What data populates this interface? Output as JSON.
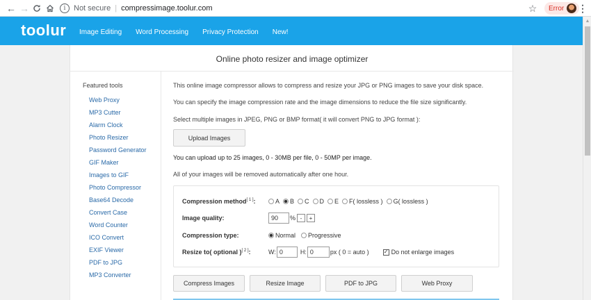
{
  "browser": {
    "not_secure": "Not secure",
    "separator": "|",
    "url": "compressimage.toolur.com",
    "error_label": "Error",
    "icons": {
      "back": "arrow-left",
      "forward": "arrow-right",
      "reload": "reload",
      "home": "home",
      "info": "info",
      "star": "star",
      "menu": "kebab-menu"
    }
  },
  "header": {
    "logo": "toolur",
    "nav": [
      "Image Editing",
      "Word Processing",
      "Privacy Protection",
      "New!"
    ],
    "accent_color": "#1aa3e8"
  },
  "page": {
    "title": "Online photo resizer and image optimizer"
  },
  "sidebar": {
    "heading": "Featured tools",
    "items": [
      "Web Proxy",
      "MP3 Cutter",
      "Alarm Clock",
      "Photo Resizer",
      "Password Generator",
      "GIF Maker",
      "Images to GIF",
      "Photo Compressor",
      "Base64 Decode",
      "Convert Case",
      "Word Counter",
      "ICO Convert",
      "EXIF Viewer",
      "PDF to JPG",
      "MP3 Converter"
    ]
  },
  "intro": {
    "p1": "This online image compressor allows to compress and resize your JPG or PNG images to save your disk space.",
    "p2": "You can specify the image compression rate and the image dimensions to reduce the file size significantly.",
    "p3": "Select multiple images in JPEG, PNG or BMP format( it will convert PNG to JPG format ):",
    "upload_button": "Upload Images",
    "limits": "You can upload up to 25 images, 0 - 30MB per file, 0 - 50MP per image.",
    "removal_note": "All of your images will be removed automatically after one hour."
  },
  "settings": {
    "method_label": "Compression method",
    "method_sup": "[ 1 ]",
    "method_suffix": ":",
    "method_options": [
      "A",
      "B",
      "C",
      "D",
      "E",
      "F( lossless )",
      "G( lossless )"
    ],
    "method_selected": "B",
    "quality_label": "Image quality:",
    "quality_value": "90",
    "quality_unit": "%",
    "quality_minus": "-",
    "quality_plus": "+",
    "type_label": "Compression type:",
    "type_options": [
      "Normal",
      "Progressive"
    ],
    "type_selected": "Normal",
    "resize_label": "Resize to( optional )",
    "resize_sup": "[ 2 ]",
    "resize_suffix": ":",
    "w_label": "W:",
    "w_value": "0",
    "h_label": "H:",
    "h_value": "0",
    "px_note": "px ( 0 = auto )",
    "no_enlarge_label": "Do not enlarge images",
    "no_enlarge_checked": true
  },
  "actions": [
    "Compress Images",
    "Resize Image",
    "PDF to JPG",
    "Web Proxy"
  ]
}
